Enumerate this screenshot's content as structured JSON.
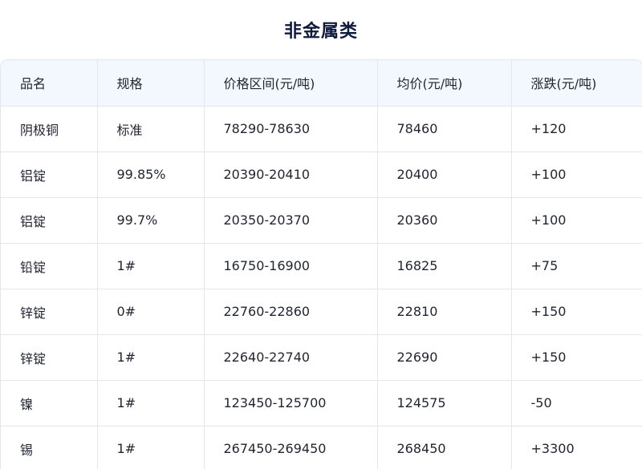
{
  "title": "非金属类",
  "table": {
    "headers": [
      "品名",
      "规格",
      "价格区间(元/吨)",
      "均价(元/吨)",
      "涨跌(元/吨)"
    ],
    "rows": [
      [
        "阴极铜",
        "标准",
        "78290-78630",
        "78460",
        "+120"
      ],
      [
        "铝锭",
        "99.85%",
        "20390-20410",
        "20400",
        "+100"
      ],
      [
        "铝锭",
        "99.7%",
        "20350-20370",
        "20360",
        "+100"
      ],
      [
        "铅锭",
        "1#",
        "16750-16900",
        "16825",
        "+75"
      ],
      [
        "锌锭",
        "0#",
        "22760-22860",
        "22810",
        "+150"
      ],
      [
        "锌锭",
        "1#",
        "22640-22740",
        "22690",
        "+150"
      ],
      [
        "镍",
        "1#",
        "123450-125700",
        "124575",
        "-50"
      ],
      [
        "锡",
        "1#",
        "267450-269450",
        "268450",
        "+3300"
      ]
    ]
  }
}
